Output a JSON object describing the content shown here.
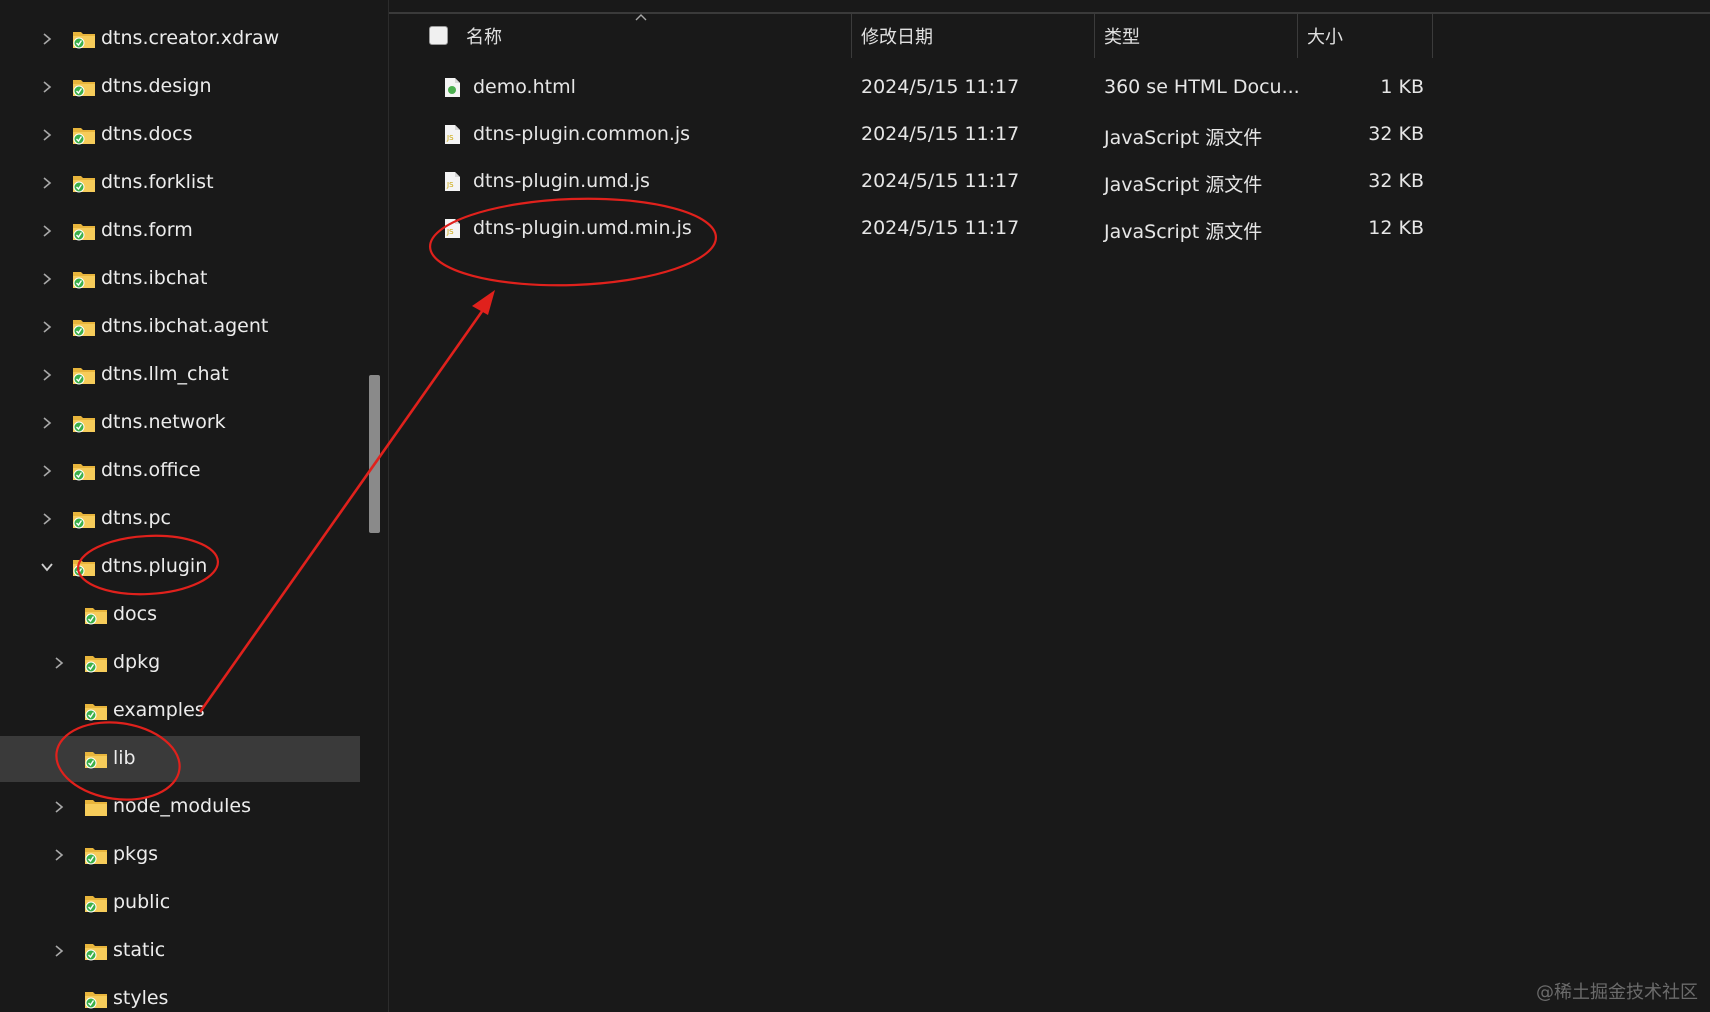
{
  "sidebar": {
    "items": [
      {
        "label": "dtns.creator.xdraw",
        "expanded": false
      },
      {
        "label": "dtns.design",
        "expanded": false
      },
      {
        "label": "dtns.docs",
        "expanded": false
      },
      {
        "label": "dtns.forklist",
        "expanded": false
      },
      {
        "label": "dtns.form",
        "expanded": false
      },
      {
        "label": "dtns.ibchat",
        "expanded": false
      },
      {
        "label": "dtns.ibchat.agent",
        "expanded": false
      },
      {
        "label": "dtns.llm_chat",
        "expanded": false
      },
      {
        "label": "dtns.network",
        "expanded": false
      },
      {
        "label": "dtns.office",
        "expanded": false
      },
      {
        "label": "dtns.pc",
        "expanded": false
      },
      {
        "label": "dtns.plugin",
        "expanded": true
      },
      {
        "label": "docs",
        "expandable": false
      },
      {
        "label": "dpkg",
        "expandable": true
      },
      {
        "label": "examples",
        "expandable": false
      },
      {
        "label": "lib",
        "expandable": false,
        "selected": true
      },
      {
        "label": "node_modules",
        "expandable": true
      },
      {
        "label": "pkgs",
        "expandable": true
      },
      {
        "label": "public",
        "expandable": false
      },
      {
        "label": "static",
        "expandable": true
      },
      {
        "label": "styles",
        "expandable": false
      }
    ]
  },
  "list": {
    "columns": {
      "name": "名称",
      "date": "修改日期",
      "type": "类型",
      "size": "大小"
    },
    "rows": [
      {
        "name": "demo.html",
        "date": "2024/5/15 11:17",
        "type": "360 se HTML Docu...",
        "size": "1 KB",
        "icon": "html-file-icon"
      },
      {
        "name": "dtns-plugin.common.js",
        "date": "2024/5/15 11:17",
        "type": "JavaScript 源文件",
        "size": "32 KB",
        "icon": "js-file-icon"
      },
      {
        "name": "dtns-plugin.umd.js",
        "date": "2024/5/15 11:17",
        "type": "JavaScript 源文件",
        "size": "32 KB",
        "icon": "js-file-icon"
      },
      {
        "name": "dtns-plugin.umd.min.js",
        "date": "2024/5/15 11:17",
        "type": "JavaScript 源文件",
        "size": "12 KB",
        "icon": "js-file-icon"
      }
    ]
  },
  "watermark": "@稀土掘金技术社区",
  "colors": {
    "background": "#191919",
    "selected_row": "#3a3a3a",
    "annotation_red": "#e0211c",
    "folder_yellow": "#f2c24f",
    "badge_green": "#3cb04a"
  }
}
